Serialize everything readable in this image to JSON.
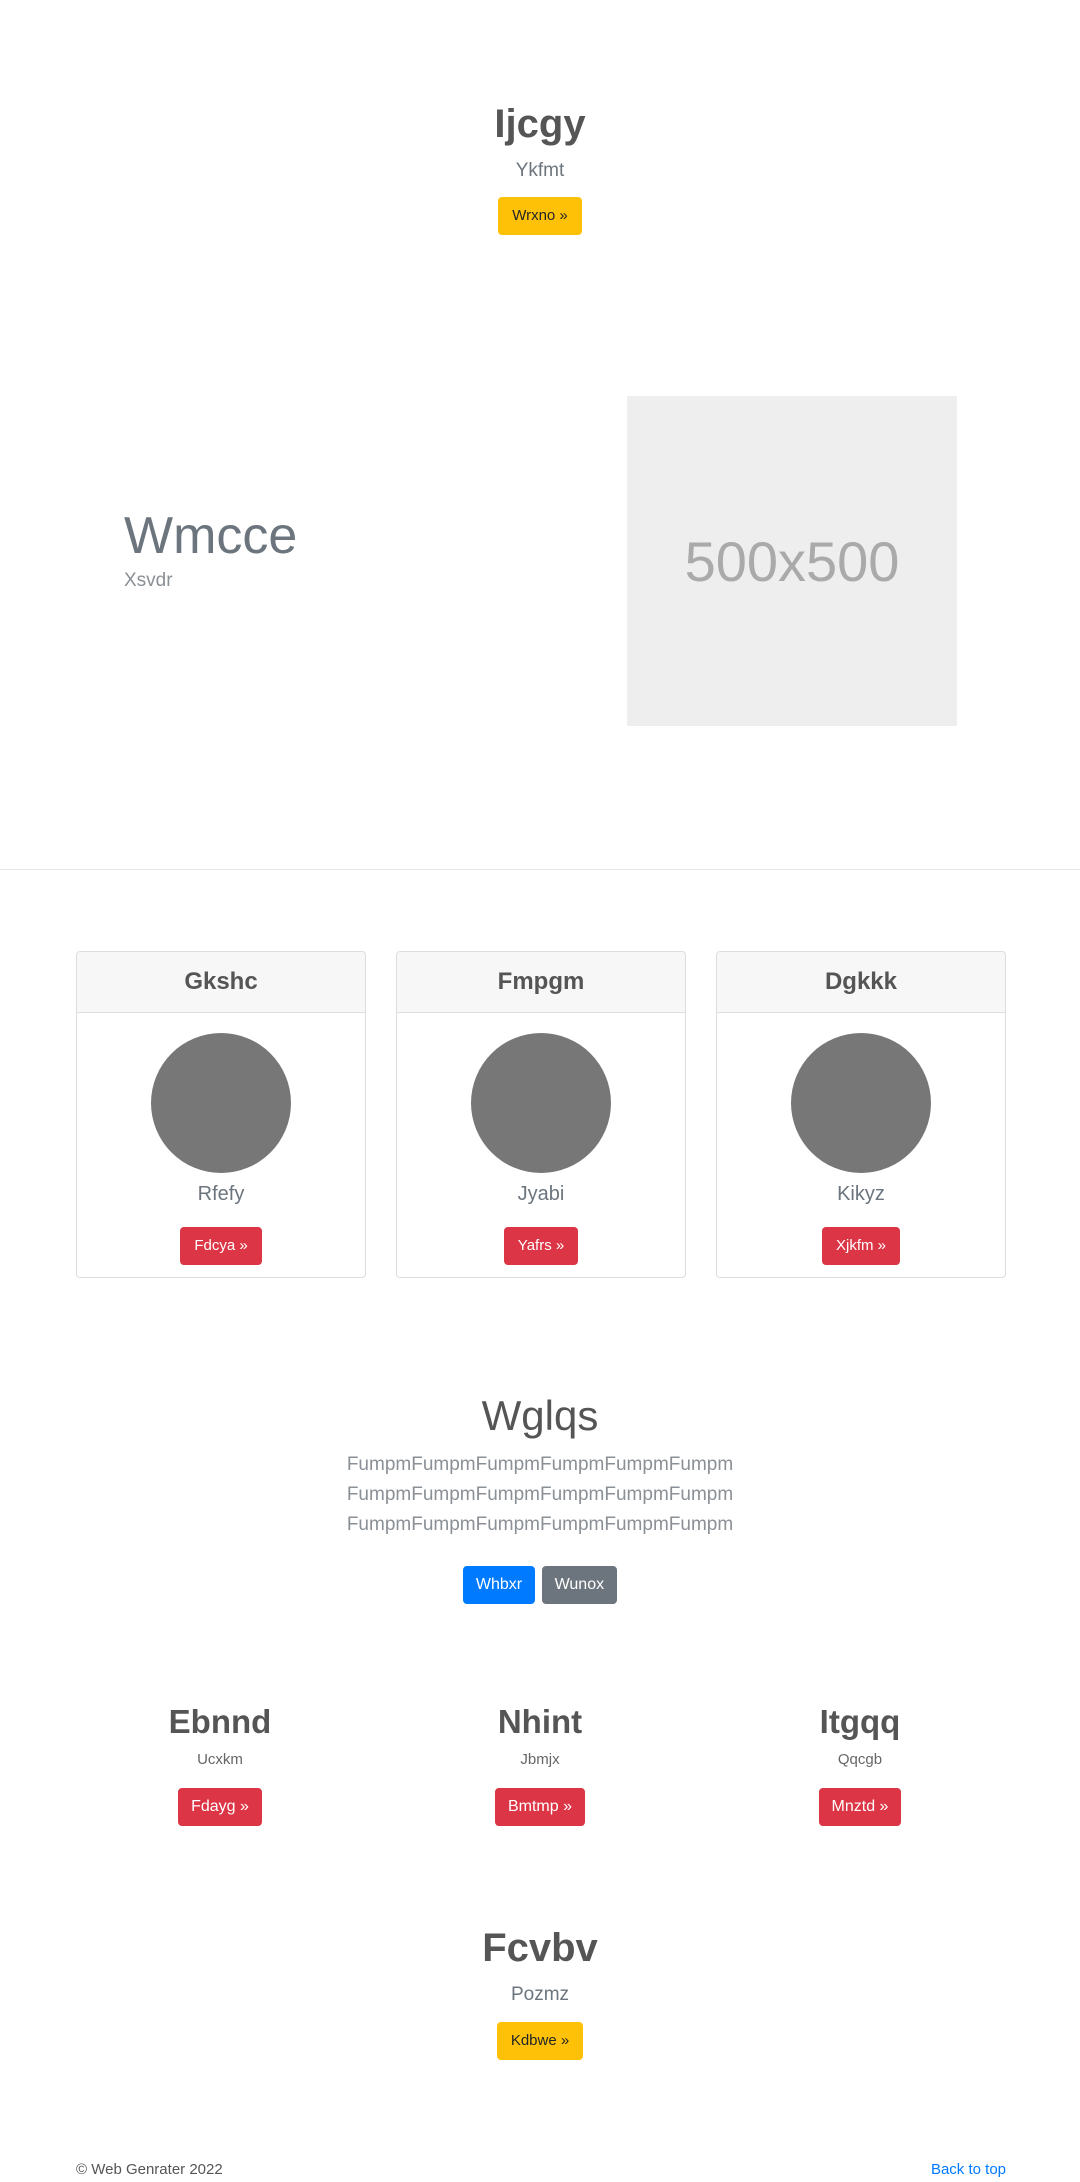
{
  "hero": {
    "title": "Ijcgy",
    "subtitle": "Ykfmt",
    "button": "Wrxno »"
  },
  "feature": {
    "title": "Wmcce",
    "subtitle": "Xsvdr",
    "image_label": "500x500"
  },
  "cards": [
    {
      "header": "Gkshc",
      "text": "Rfefy",
      "button": "Fdcya »"
    },
    {
      "header": "Fmpgm",
      "text": "Jyabi",
      "button": "Yafrs »"
    },
    {
      "header": "Dgkkk",
      "text": "Kikyz",
      "button": "Xjkfm »"
    }
  ],
  "section": {
    "title": "Wglqs",
    "lines": [
      "FumpmFumpmFumpmFumpmFumpmFumpm",
      "FumpmFumpmFumpmFumpmFumpmFumpm",
      "FumpmFumpmFumpmFumpmFumpmFumpm"
    ],
    "primary_button": "Whbxr",
    "secondary_button": "Wunox"
  },
  "columns": [
    {
      "title": "Ebnnd",
      "text": "Ucxkm",
      "button": "Fdayg »"
    },
    {
      "title": "Nhint",
      "text": "Jbmjx",
      "button": "Bmtmp »"
    },
    {
      "title": "Itgqq",
      "text": "Qqcgb",
      "button": "Mnztd »"
    }
  ],
  "hero2": {
    "title": "Fcvbv",
    "subtitle": "Pozmz",
    "button": "Kdbwe »"
  },
  "footer": {
    "copyright": "© Web Genrater 2022",
    "back_to_top": "Back to top"
  },
  "colors": {
    "warning": "#ffc107",
    "danger": "#dc3545",
    "primary": "#007bff",
    "secondary": "#6c757d",
    "link": "#007bff"
  }
}
